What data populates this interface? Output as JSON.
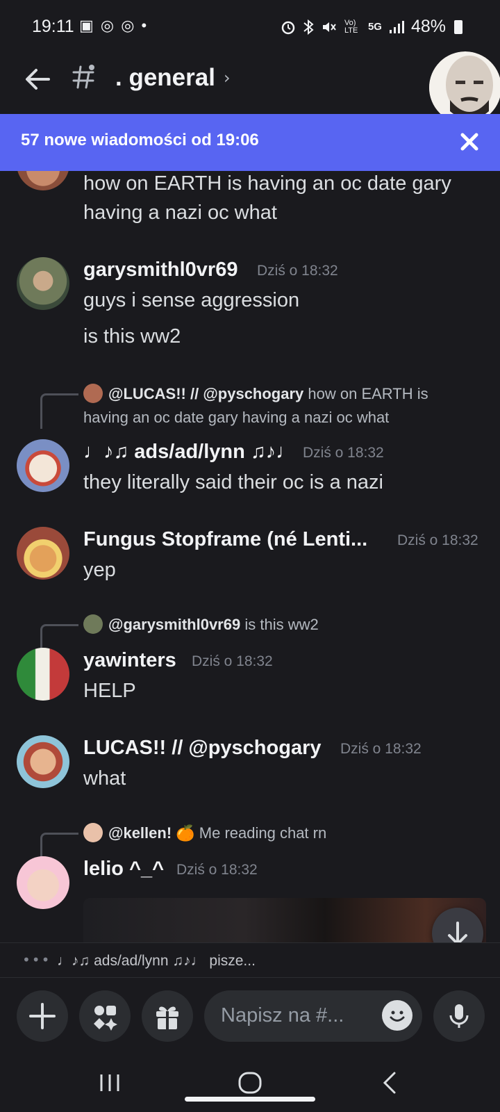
{
  "status_bar": {
    "time": "19:11",
    "app_icons": "▣ ◎ ◎ •",
    "network": "Vo) LTE",
    "five_g": "5G",
    "battery": "48%"
  },
  "header": {
    "channel_name": ". general"
  },
  "banner": {
    "text": "57 nowe wiadomości od 19:06"
  },
  "messages": [
    {
      "lines": [
        "how on EARTH is having an oc date gary",
        "having a nazi oc what"
      ]
    },
    {
      "username": "garysmithl0vr69",
      "timestamp": "Dziś o 18:32",
      "lines": [
        "guys i sense aggression",
        "is this ww2"
      ]
    },
    {
      "reply_user": "@LUCAS!! // @pyschogary",
      "reply_text_1": "how on EARTH is",
      "reply_text_2": "having an oc date gary having a nazi oc what",
      "username": "♩♪♫ ads/ad/lynn ♫♪♩",
      "timestamp": "Dziś o 18:32",
      "lines": [
        "they literally said their oc is a nazi"
      ]
    },
    {
      "username": "Fungus Stopframe (né Lenti...",
      "timestamp": "Dziś o 18:32",
      "lines": [
        "yep"
      ]
    },
    {
      "reply_user": "@garysmithl0vr69",
      "reply_text_1": "is this ww2",
      "username": "yawinters",
      "timestamp": "Dziś o 18:32",
      "lines": [
        "HELP"
      ]
    },
    {
      "username": "LUCAS!! // @pyschogary",
      "timestamp": "Dziś o 18:32",
      "lines": [
        "what"
      ]
    },
    {
      "reply_user": "@kellen! 🍊",
      "reply_text_1": "Me reading chat rn",
      "username": "lelio ^_^",
      "timestamp": "Dziś o 18:32"
    }
  ],
  "typing": {
    "dots": "•••",
    "text": "♩♪♫ ads/ad/lynn ♫♪♩ pisze..."
  },
  "composer": {
    "placeholder": "Napisz na #..."
  },
  "colors": {
    "background": "#1a1a1e",
    "banner": "#5865f2",
    "surface": "#2b2d31"
  }
}
